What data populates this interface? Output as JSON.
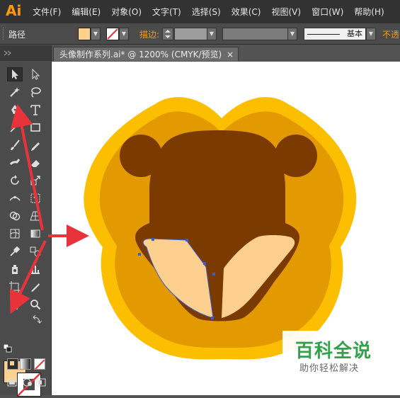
{
  "app": {
    "logo": "Ai"
  },
  "menu": [
    "文件(F)",
    "编辑(E)",
    "对象(O)",
    "文字(T)",
    "选择(S)",
    "效果(C)",
    "视图(V)",
    "窗口(W)",
    "帮助(H)"
  ],
  "control_bar": {
    "selection_label": "路径",
    "fill_color": "#fdd08f",
    "stroke_label": "描边:",
    "stroke_profile": "基本",
    "opacity_label": "不透"
  },
  "document_tab": {
    "title": "头像制作系列.ai* @ 1200% (CMYK/预览)",
    "close": "×"
  },
  "toolbox": {
    "tools": [
      "selection-icon",
      "direct-selection-icon",
      "magic-wand-icon",
      "lasso-icon",
      "pen-icon",
      "type-icon",
      "line-icon",
      "rectangle-icon",
      "paintbrush-icon",
      "pencil-icon",
      "blob-brush-icon",
      "eraser-icon",
      "rotate-icon",
      "scale-icon",
      "width-icon",
      "free-transform-icon",
      "shape-builder-icon",
      "perspective-grid-icon",
      "mesh-icon",
      "gradient-icon",
      "eyedropper-icon",
      "blend-icon",
      "symbol-sprayer-icon",
      "column-graph-icon",
      "artboard-icon",
      "slice-icon",
      "hand-icon",
      "zoom-icon"
    ],
    "fill_color": "#fdd08f"
  },
  "artwork": {
    "outer_color": "#fbbf00",
    "inner_color": "#e39a00",
    "head_color": "#7a3a00",
    "muzzle_color": "#fdd08f"
  },
  "watermark": {
    "title": "百科全说",
    "subtitle": "助你轻松解决"
  },
  "colors": {
    "accent": "#ff9a00",
    "annotation_arrow": "#e8333a",
    "path_selection": "#3a5fd0"
  }
}
